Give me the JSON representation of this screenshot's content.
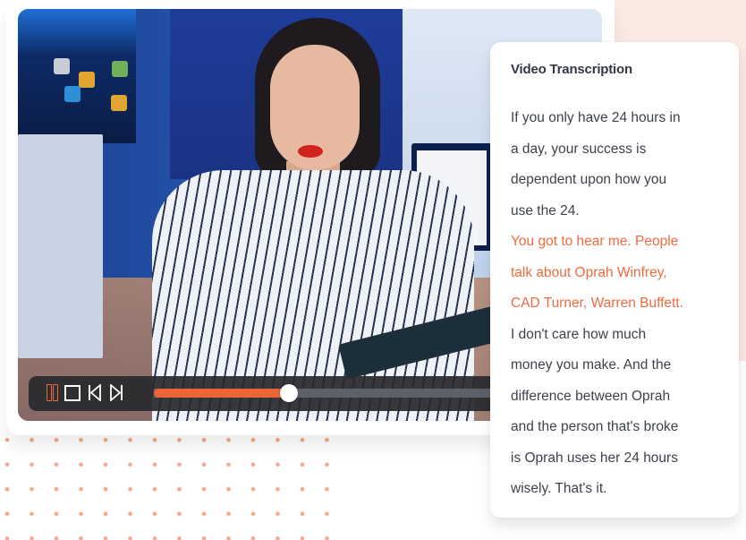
{
  "theme": {
    "accent": "#f26a3d",
    "pink_background": "#fbe9e3",
    "control_bar": "#2a2c30",
    "text_dark": "#343846",
    "text_body": "#3e424d"
  },
  "video": {
    "description": "woman speaking to camera in office",
    "controls": {
      "pause_icon": "pause-icon",
      "stop_icon": "stop-icon",
      "previous_icon": "skip-back-icon",
      "next_icon": "skip-forward-icon",
      "progress_fraction": 0.36
    }
  },
  "transcript": {
    "title": "Video Transcription",
    "lines": [
      {
        "text": "If you only have 24 hours in",
        "highlight": false
      },
      {
        "text": "a day, your success is",
        "highlight": false
      },
      {
        "text": "dependent upon how you",
        "highlight": false
      },
      {
        "text": "use the 24.",
        "highlight": false
      },
      {
        "text": "You got to hear me. People",
        "highlight": true
      },
      {
        "text": "talk about Oprah Winfrey,",
        "highlight": true
      },
      {
        "text": "CAD Turner, Warren Buffett.",
        "highlight": true
      },
      {
        "text": "I don't care how much",
        "highlight": false
      },
      {
        "text": "money you make. And the",
        "highlight": false
      },
      {
        "text": "difference between Oprah",
        "highlight": false
      },
      {
        "text": "and the person that's broke",
        "highlight": false
      },
      {
        "text": "is Oprah uses her 24 hours",
        "highlight": false
      },
      {
        "text": "wisely. That's it.",
        "highlight": false
      }
    ]
  }
}
